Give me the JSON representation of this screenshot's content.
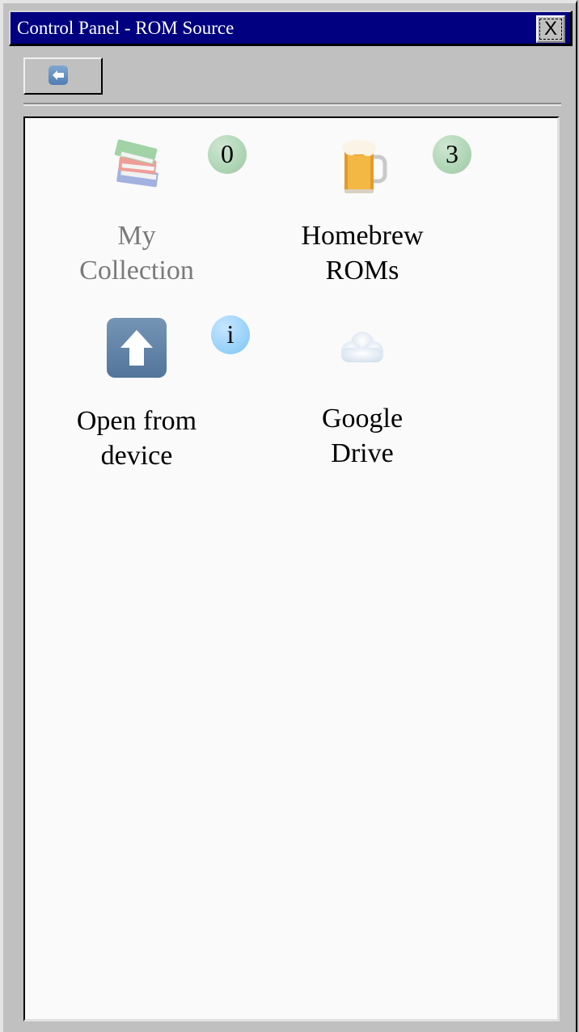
{
  "window": {
    "title": "Control Panel - ROM Source",
    "close_label": "X"
  },
  "toolbar": {
    "back_icon": "back-arrow-icon"
  },
  "sources": [
    {
      "label_line1": "My",
      "label_line2": "Collection",
      "icon": "books-icon",
      "badge": "0",
      "badge_color": "#a9d3b0",
      "disabled": true
    },
    {
      "label_line1": "Homebrew",
      "label_line2": "ROMs",
      "icon": "beer-mug-icon",
      "badge": "3",
      "badge_color": "#a9d3b0",
      "disabled": false
    },
    {
      "label_line1": "Open from",
      "label_line2": "device",
      "icon": "upload-arrow-icon",
      "badge": "i",
      "badge_color": "#8fcdf8",
      "disabled": false
    },
    {
      "label_line1": "Google",
      "label_line2": "Drive",
      "icon": "cloud-icon",
      "badge": null,
      "disabled": false
    }
  ],
  "colors": {
    "titlebar": "#000080",
    "window_bg": "#c0c0c0",
    "content_bg": "#fafafa"
  }
}
